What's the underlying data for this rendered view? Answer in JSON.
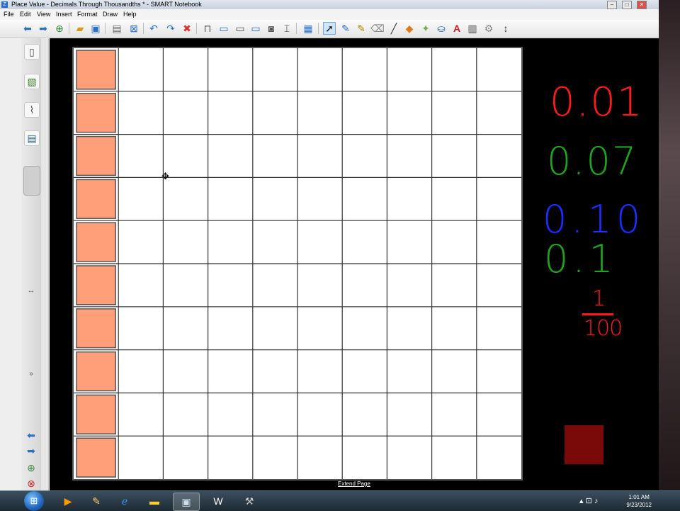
{
  "window": {
    "title": "Place Value - Decimals Through Thousandths * - SMART Notebook",
    "app_icon": "Z",
    "controls": [
      "–",
      "□",
      "✕"
    ]
  },
  "menu": [
    "File",
    "Edit",
    "View",
    "Insert",
    "Format",
    "Draw",
    "Help"
  ],
  "toolbar": {
    "icons": [
      "back-icon",
      "forward-icon",
      "add-page-icon",
      "open-icon",
      "save-icon",
      "paste-icon",
      "delete-page-icon",
      "undo-icon",
      "redo-icon",
      "delete-icon",
      "screen-shade-icon",
      "full-screen-icon",
      "dual-page-icon",
      "capture-icon",
      "camera-icon",
      "insert-table-icon",
      "select-icon",
      "pen-icon",
      "creative-pen-icon",
      "eraser-icon",
      "line-icon",
      "shapes-icon",
      "magic-pen-icon",
      "fill-icon",
      "text-icon",
      "properties-icon",
      "move-toolbar-icon"
    ],
    "text_tool_label": "A"
  },
  "sidebar": {
    "icons": [
      "page-sorter-icon",
      "gallery-icon",
      "attachments-icon",
      "properties-icon"
    ]
  },
  "page": {
    "extend_label": "Extend Page",
    "rows": 10,
    "cols": 10,
    "shaded_cells": 10,
    "shade_color": "#ff9f7a"
  },
  "annotations": {
    "line1": "0.01",
    "line2": "0.07",
    "line3": "0.10",
    "line4": "0.1",
    "frac_num": "1",
    "frac_den": "100",
    "colors": {
      "red": "#ff1a1a",
      "green": "#1fa31f",
      "blue": "#1c2dff"
    }
  },
  "dark_square_color": "#7a0a0a",
  "taskbar": {
    "time": "1:01 AM",
    "date": "9/23/2012",
    "apps": [
      "media-player-icon",
      "paint-icon",
      "ie-icon",
      "explorer-icon",
      "smart-notebook-icon",
      "word-icon",
      "tools-icon"
    ]
  }
}
